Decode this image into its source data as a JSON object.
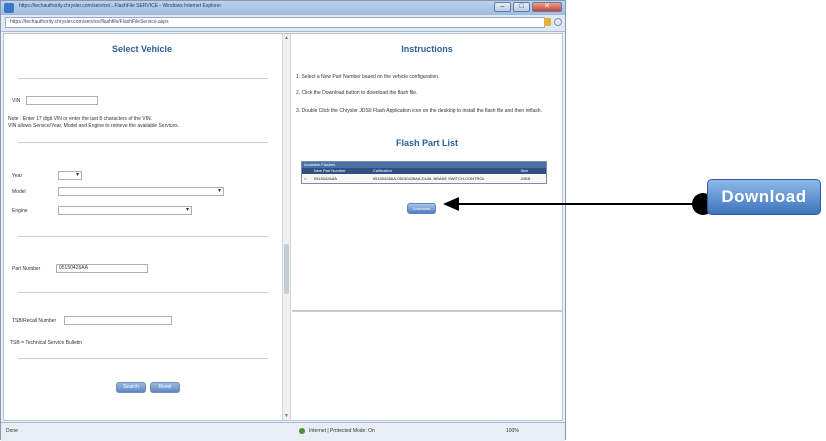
{
  "window": {
    "title": "https://techauthority.chrysler.com/service/...FlashFile SERVICE - Windows Internet Explorer",
    "address": "https://techauthority.chrysler.com/service/flashfile/FlashFileService.aspx",
    "buttons": [
      "–",
      "□",
      "✕"
    ]
  },
  "left": {
    "title": "Select Vehicle",
    "vin_label": "VIN",
    "vin_value": "",
    "note": "Note : Enter 17 digit VIN or enter the last 8 characters of the VIN.",
    "note2": "VIN allows Service/Year, Model and Engine to retrieve the available Services.",
    "year_label": "Year",
    "model_label": "Model",
    "engine_label": "Engine",
    "part_number_label": "Part Number",
    "part_number_value": "05150426AA",
    "tsb_label": "TSB/Recall Number",
    "tsb_note": "TSB = Technical Service Bulletin",
    "btn_search": "Search",
    "btn_reset": "Reset"
  },
  "right": {
    "title": "Instructions",
    "step1": "1. Select a New Part Number based on the vehicle configuration.",
    "step2": "2. Click the Download button to download the flash file.",
    "step3": "3. Double Click the Chrysler JDSII Flash Application icon on the desktop to install the flash file and then reflash.",
    "flash_title": "Flash Part List",
    "table_header": "Available Flashes",
    "columns": [
      "",
      "New Part Number",
      "Calibration",
      "Size"
    ],
    "rows": [
      [
        "",
        "05150426AA",
        "05150426AA-05150426AA-DUAL BRAKE SWITCH-CONTROL",
        "24KB"
      ]
    ],
    "download_small": "Download"
  },
  "status": {
    "left": "Done",
    "zone": "Internet | Protected Mode: On",
    "zoom": "100%"
  },
  "callout": {
    "label": "Download"
  }
}
